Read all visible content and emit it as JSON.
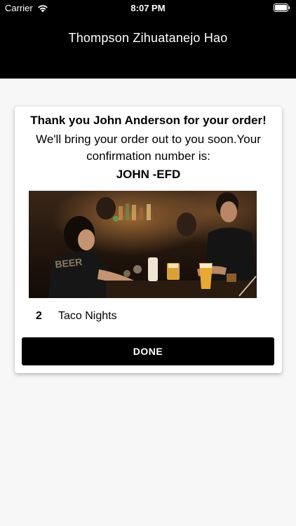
{
  "status_bar": {
    "carrier": "Carrier",
    "time": "8:07 PM"
  },
  "nav": {
    "title": "Thompson Zihuatanejo Hao"
  },
  "confirmation": {
    "thanks_text": "Thank you John Anderson for your order!",
    "message": "We'll bring your order out to you soon.Your confirmation number is:",
    "number": "JOHN -EFD"
  },
  "order": {
    "items": [
      {
        "quantity": "2",
        "name": "Taco Nights"
      }
    ]
  },
  "actions": {
    "done_label": "DONE"
  },
  "colors": {
    "header_bg": "#000000",
    "page_bg": "#f7f7f7",
    "button_bg": "#000000"
  },
  "icons": {
    "wifi": "wifi-icon",
    "battery": "battery-icon"
  }
}
